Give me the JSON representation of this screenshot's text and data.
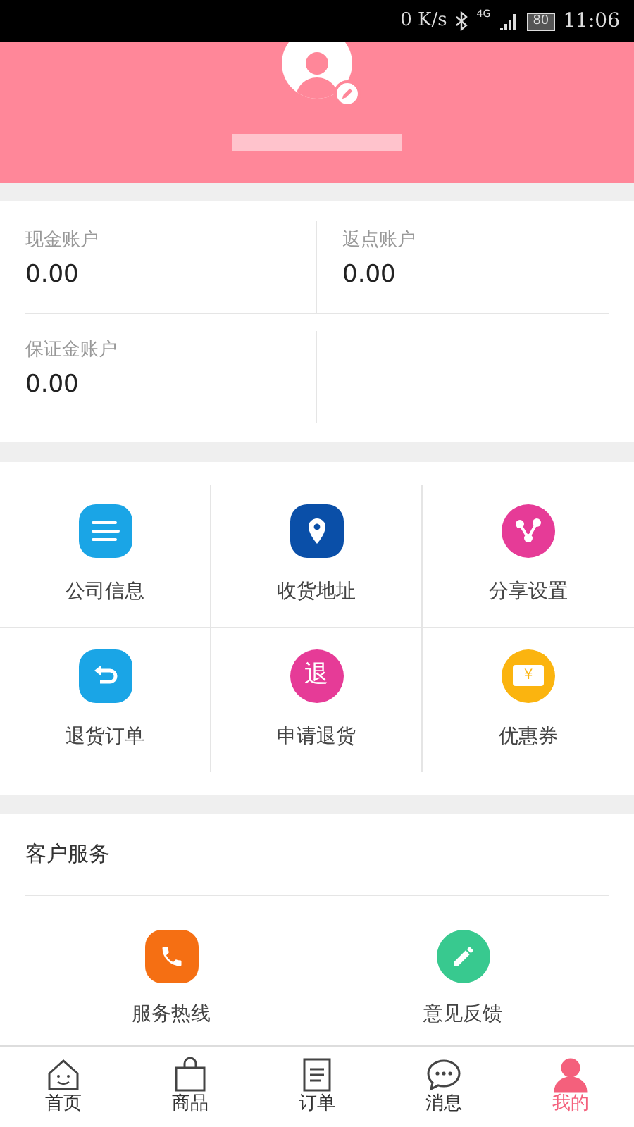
{
  "status_bar": {
    "speed": "0 K/s",
    "network": "4G",
    "battery": "80",
    "time": "11:06"
  },
  "accounts": [
    {
      "label": "现金账户",
      "value": "0.00"
    },
    {
      "label": "返点账户",
      "value": "0.00"
    },
    {
      "label": "保证金账户",
      "value": "0.00"
    }
  ],
  "menu": [
    {
      "kind": "info",
      "label": "公司信息",
      "color": "#1aa5e6"
    },
    {
      "kind": "location",
      "label": "收货地址",
      "color": "#0a4fa8"
    },
    {
      "kind": "share",
      "label": "分享设置",
      "color": "#e63b97"
    },
    {
      "kind": "return",
      "label": "退货订单",
      "color": "#1aa5e6"
    },
    {
      "kind": "glyph",
      "label": "申请退货",
      "color": "#e63b97",
      "glyph": "退"
    },
    {
      "kind": "coupon",
      "label": "优惠券",
      "color": "#fbb40f",
      "glyph": "¥"
    }
  ],
  "service": {
    "title": "客户服务",
    "items": [
      {
        "kind": "phone",
        "label": "服务热线",
        "color": "#f56f13"
      },
      {
        "kind": "edit",
        "label": "意见反馈",
        "color": "#38c98f"
      }
    ]
  },
  "nav": [
    {
      "kind": "home",
      "label": "首页",
      "selected": false
    },
    {
      "kind": "bag",
      "label": "商品",
      "selected": false
    },
    {
      "kind": "order",
      "label": "订单",
      "selected": false
    },
    {
      "kind": "chat",
      "label": "消息",
      "selected": false
    },
    {
      "kind": "user",
      "label": "我的",
      "selected": true
    }
  ]
}
